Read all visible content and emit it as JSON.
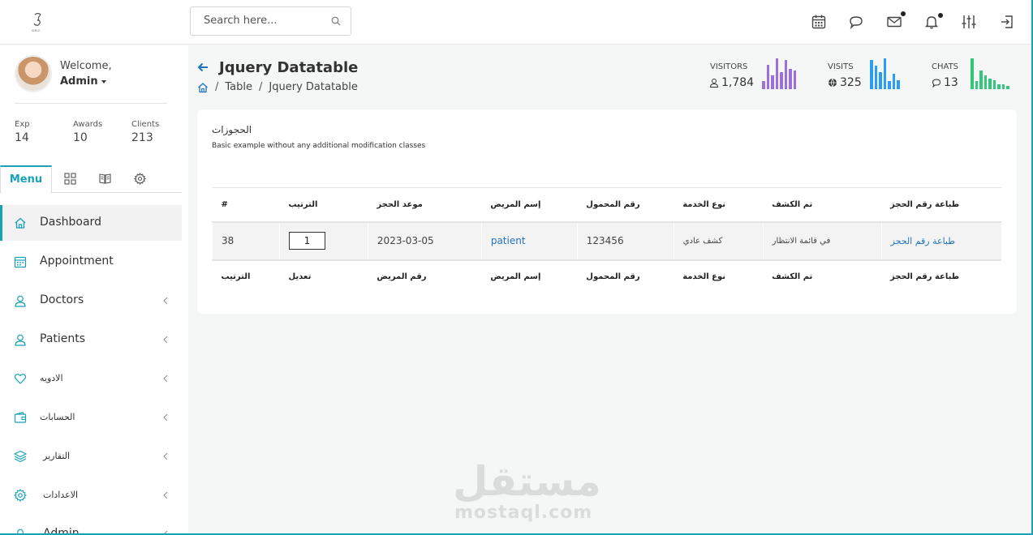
{
  "colors": {
    "accent": "#17a2b8",
    "visitors": "#9c6fe0",
    "visits": "#2a9df4",
    "chats": "#34c77b",
    "link": "#1e73be"
  },
  "search": {
    "placeholder": "Search here..."
  },
  "topbar_icons": [
    "calendar-icon",
    "chat-icon",
    "mail-icon",
    "bell-icon",
    "sliders-icon",
    "logout-icon"
  ],
  "profile": {
    "welcome": "Welcome,",
    "name": "Admin"
  },
  "stats": [
    {
      "label": "Exp",
      "value": "14"
    },
    {
      "label": "Awards",
      "value": "10"
    },
    {
      "label": "Clients",
      "value": "213"
    }
  ],
  "sidebar_tabs": {
    "menu": "Menu"
  },
  "nav": [
    {
      "label": "Dashboard",
      "icon": "home-icon"
    },
    {
      "label": "Appointment",
      "icon": "calendar-icon"
    },
    {
      "label": "Doctors",
      "icon": "user-icon"
    },
    {
      "label": "Patients",
      "icon": "user-icon"
    },
    {
      "label": "الادويه",
      "icon": "heart-icon"
    },
    {
      "label": "الحسابات",
      "icon": "wallet-icon"
    },
    {
      "label": "التقارير",
      "icon": "layers-icon"
    },
    {
      "label": "الاعدادات",
      "icon": "gear-icon"
    },
    {
      "label": "Admin",
      "icon": "user-icon"
    }
  ],
  "header": {
    "title": "Jquery Datatable",
    "breadcrumb": [
      "Table",
      "Jquery Datatable"
    ]
  },
  "metrics": [
    {
      "label": "VISITORS",
      "value": "1,784",
      "bars": [
        0.25,
        0.8,
        0.45,
        1.0,
        0.55,
        0.95,
        0.65,
        0.6
      ]
    },
    {
      "label": "VISITS",
      "value": "325",
      "bars": [
        0.95,
        0.75,
        0.55,
        1.0,
        0.25,
        0.5,
        0.3
      ]
    },
    {
      "label": "CHATS",
      "value": "13",
      "bars": [
        1.0,
        0.25,
        0.6,
        0.45,
        0.35,
        0.3,
        0.15,
        0.15,
        0.1
      ]
    }
  ],
  "card": {
    "title": "الحجوزات",
    "subtitle": "Basic example without any additional modification classes"
  },
  "table": {
    "headers": [
      "#",
      "الترتيب",
      "موعد الحجز",
      "إسم المريض",
      "رقم المحمول",
      "نوع الخدمة",
      "تم الكشف",
      "طباعة رقم الحجز"
    ],
    "row": {
      "id": "38",
      "order": "1",
      "date": "2023-03-05",
      "patient": "patient",
      "mobile": "123456",
      "service": "كشف عادي",
      "status": "في قائمة الانتظار",
      "print": "طباعة رقم الحجز"
    },
    "footers": [
      "الترتيب",
      "تعديل",
      "رقم المريض",
      "إسم المريض",
      "رقم المحمول",
      "نوع الخدمة",
      "تم الكشف",
      "طباعة رقم الحجز"
    ]
  },
  "watermark": {
    "arabic": "مستقل",
    "latin": "mostaql.com"
  }
}
